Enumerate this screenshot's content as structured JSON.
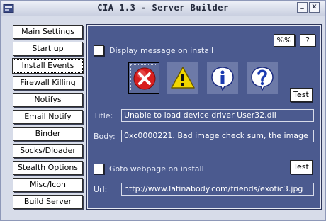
{
  "window": {
    "title": "CIA 1.3 - Server Builder",
    "close_glyph": "x",
    "minimize_glyph": "_"
  },
  "sidebar": {
    "items": [
      {
        "label": "Main Settings",
        "name": "sidebar-item-main-settings"
      },
      {
        "label": "Start up",
        "name": "sidebar-item-start-up"
      },
      {
        "label": "Install Events",
        "name": "sidebar-item-install-events",
        "active": true
      },
      {
        "label": "Firewall Killing",
        "name": "sidebar-item-firewall-killing"
      },
      {
        "label": "Notifys",
        "name": "sidebar-item-notifys"
      },
      {
        "label": "Email Notify",
        "name": "sidebar-item-email-notify"
      },
      {
        "label": "Binder",
        "name": "sidebar-item-binder"
      },
      {
        "label": "Socks/Dloader",
        "name": "sidebar-item-socks-dloader"
      },
      {
        "label": "Stealth Options",
        "name": "sidebar-item-stealth-options"
      },
      {
        "label": "Misc/Icon",
        "name": "sidebar-item-misc-icon"
      },
      {
        "label": "Build Server",
        "name": "sidebar-item-build-server"
      }
    ]
  },
  "install_events": {
    "percent_button": "%%",
    "help_button": "?",
    "message": {
      "checkbox_label": "Display message on install",
      "checked": false,
      "icons": [
        {
          "name": "error-icon",
          "selected": true
        },
        {
          "name": "warning-icon",
          "selected": false
        },
        {
          "name": "information-icon",
          "selected": false
        },
        {
          "name": "question-icon",
          "selected": false
        }
      ],
      "test_button": "Test",
      "title_label": "Title:",
      "title_value": "Unable to load device driver User32.dll",
      "body_label": "Body:",
      "body_value": "0xc0000221. Bad image check sum, the image"
    },
    "webpage": {
      "checkbox_label": "Goto webpage on install",
      "checked": false,
      "test_button": "Test",
      "url_label": "Url:",
      "url_value": "http://www.latinabody.com/friends/exotic3.jpg"
    }
  },
  "colors": {
    "panel": "#4b5a8f",
    "window": "#d7dce9",
    "field_text": "#ffffff"
  }
}
